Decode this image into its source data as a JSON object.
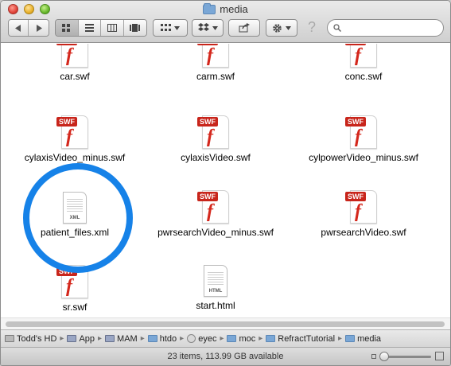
{
  "window": {
    "title": "media"
  },
  "toolbar": {
    "back_icon": "back-arrow-icon",
    "forward_icon": "forward-arrow-icon",
    "view_icons": [
      "icon-view-icon",
      "list-view-icon",
      "column-view-icon",
      "coverflow-view-icon"
    ],
    "arrange_icon": "arrange-grid-icon",
    "dropbox_icon": "dropbox-icon",
    "share_icon": "share-icon",
    "action_icon": "gear-icon",
    "help_glyph": "?",
    "search_placeholder": "",
    "search_value": ""
  },
  "files": [
    {
      "name": "car.swf",
      "type": "swf"
    },
    {
      "name": "carm.swf",
      "type": "swf"
    },
    {
      "name": "conc.swf",
      "type": "swf"
    },
    {
      "name": "cylaxisVideo_minus.swf",
      "type": "swf"
    },
    {
      "name": "cylaxisVideo.swf",
      "type": "swf"
    },
    {
      "name": "cylpowerVideo_minus.swf",
      "type": "swf"
    },
    {
      "name": "patient_files.xml",
      "type": "xml"
    },
    {
      "name": "pwrsearchVideo_minus.swf",
      "type": "swf"
    },
    {
      "name": "pwrsearchVideo.swf",
      "type": "swf"
    },
    {
      "name": "sr.swf",
      "type": "swf"
    },
    {
      "name": "start.html",
      "type": "html"
    }
  ],
  "icon_tags": {
    "swf": "SWF",
    "xml": "XML",
    "html": "HTML"
  },
  "pathbar": {
    "items": [
      "Todd's HD",
      "App",
      "MAM",
      "htdo",
      "eyec",
      "moc",
      "RefractTutorial",
      "media"
    ],
    "separator": "▸"
  },
  "status": {
    "text": "23 items, 113.99 GB available"
  },
  "colors": {
    "highlight_ring": "#1682e8",
    "swf_red": "#c8251b"
  }
}
